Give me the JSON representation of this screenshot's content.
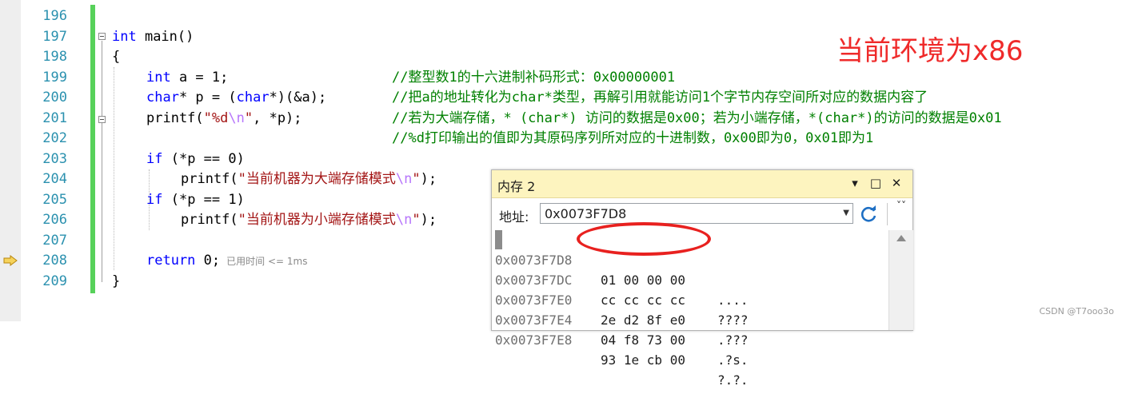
{
  "editor": {
    "line_numbers": [
      "196",
      "197",
      "198",
      "199",
      "200",
      "201",
      "202",
      "203",
      "204",
      "205",
      "206",
      "207",
      "208",
      "209"
    ],
    "lines": {
      "l197_kw": "int",
      "l197_rest": " main()",
      "l198": "{",
      "l199_kw": "int",
      "l199_rest": " a = 1;",
      "l199_cmt": "//整型数1的十六进制补码形式：0x00000001",
      "l200_kw1": "char",
      "l200_a": "* p = (",
      "l200_kw2": "char",
      "l200_b": "*)(&a);",
      "l200_cmt": "//把a的地址转化为char*类型，再解引用就能访问1个字节内存空间所对应的数据内容了",
      "l201_a": "printf(",
      "l201_str1": "\"%d",
      "l201_esc": "\\n",
      "l201_str2": "\"",
      "l201_b": ", *p);",
      "l201_cmt": "//若为大端存储，* (char*) 访问的数据是0x00；若为小端存储，*(char*)的访问的数据是0x01",
      "l202_cmt": "//%d打印输出的值即为其原码序列所对应的十进制数，0x00即为0，0x01即为1",
      "l203_kw": "if",
      "l203_rest": " (*p == 0)",
      "l204_a": "printf(",
      "l204_str": "\"当前机器为大端存储模式",
      "l204_esc": "\\n",
      "l204_str2": "\"",
      "l204_b": ");",
      "l205_kw": "if",
      "l205_rest": " (*p == 1)",
      "l206_a": "printf(",
      "l206_str": "\"当前机器为小端存储模式",
      "l206_esc": "\\n",
      "l206_str2": "\"",
      "l206_b": ");",
      "l208_kw": "return",
      "l208_rest": " 0;",
      "l208_hint": "已用时间 <= 1ms",
      "l209": "}"
    }
  },
  "annotation": {
    "text": "当前环境为x86",
    "color": "#ef2a2a"
  },
  "memory_window": {
    "title": "内存 2",
    "dropdown_icon": "▾",
    "maximize_icon": "□",
    "close_icon": "✕",
    "address_label": "地址:",
    "address_value": "0x0073F7D8",
    "rows": [
      {
        "addr": "0x0073F7D8",
        "bytes": "01 00 00 00",
        "ascii": "...."
      },
      {
        "addr": "0x0073F7DC",
        "bytes": "cc cc cc cc",
        "ascii": "????"
      },
      {
        "addr": "0x0073F7E0",
        "bytes": "2e d2 8f e0",
        "ascii": ".???"
      },
      {
        "addr": "0x0073F7E4",
        "bytes": "04 f8 73 00",
        "ascii": ".?s."
      },
      {
        "addr": "0x0073F7E8",
        "bytes": "93 1e cb 00",
        "ascii": "?.?."
      }
    ]
  },
  "watermark": "CSDN @T7ooo3o",
  "colors": {
    "keyword": "#0000ff",
    "string": "#a31515",
    "comment": "#008000",
    "line_number": "#2b91af",
    "change_bar": "#57d15a",
    "titlebar": "#fdf4bf"
  }
}
